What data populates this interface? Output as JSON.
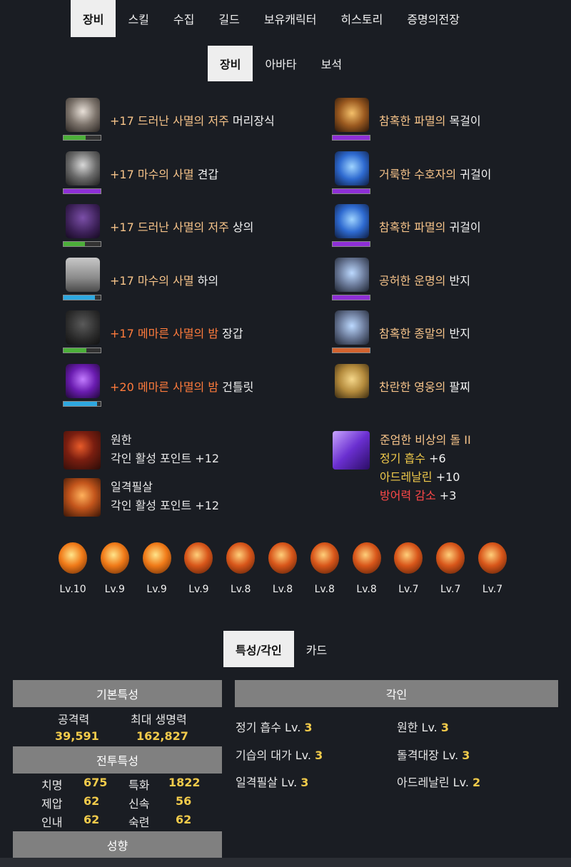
{
  "main_tabs": [
    "장비",
    "스킬",
    "수집",
    "길드",
    "보유캐릭터",
    "히스토리",
    "증명의전장"
  ],
  "sub_tabs": [
    "장비",
    "아바타",
    "보석"
  ],
  "equipment_left": [
    {
      "prefix": "+17 드러난 사멸의 저주",
      "slot": "머리장식",
      "prefix_color": "orange",
      "quality_color": "#4caf3a",
      "quality": 60,
      "icon": "helmet-icon"
    },
    {
      "prefix": "+17 마수의 사멸",
      "slot": "견갑",
      "prefix_color": "orange",
      "quality_color": "#8e2fd6",
      "quality": 100,
      "icon": "shoulder-icon"
    },
    {
      "prefix": "+17 드러난 사멸의 저주",
      "slot": "상의",
      "prefix_color": "orange",
      "quality_color": "#4caf3a",
      "quality": 58,
      "icon": "chest-icon"
    },
    {
      "prefix": "+17 마수의 사멸",
      "slot": "하의",
      "prefix_color": "orange",
      "quality_color": "#2ea8e0",
      "quality": 85,
      "icon": "pants-icon"
    },
    {
      "prefix": "+17 메마른 사멸의 밤",
      "slot": "장갑",
      "prefix_color": "red-orange",
      "quality_color": "#4caf3a",
      "quality": 62,
      "icon": "gloves-icon"
    },
    {
      "prefix": "+20 메마른 사멸의 밤",
      "slot": "건틀릿",
      "prefix_color": "red-orange",
      "quality_color": "#2ea8e0",
      "quality": 90,
      "icon": "gauntlet-icon"
    }
  ],
  "equipment_right": [
    {
      "prefix": "참혹한 파멸의",
      "slot": "목걸이",
      "quality_color": "#8e2fd6",
      "quality": 100,
      "icon": "necklace-icon"
    },
    {
      "prefix": "거룩한 수호자의",
      "slot": "귀걸이",
      "quality_color": "#8e2fd6",
      "quality": 100,
      "icon": "earring-icon"
    },
    {
      "prefix": "참혹한 파멸의",
      "slot": "귀걸이",
      "quality_color": "#8e2fd6",
      "quality": 100,
      "icon": "earring-icon"
    },
    {
      "prefix": "공허한 운명의",
      "slot": "반지",
      "quality_color": "#8e2fd6",
      "quality": 100,
      "icon": "ring-icon"
    },
    {
      "prefix": "참혹한 종말의",
      "slot": "반지",
      "quality_color": "#d3632f",
      "quality": 100,
      "icon": "ring-icon"
    },
    {
      "prefix": "찬란한 영웅의",
      "slot": "팔찌",
      "quality_color": "",
      "quality": 0,
      "icon": "bracelet-icon"
    }
  ],
  "engravings_books": [
    {
      "name": "원한",
      "effect": "각인 활성 포인트 +12",
      "icon": "grudge-icon"
    },
    {
      "name": "일격필살",
      "effect": "각인 활성 포인트 +12",
      "icon": "one-shot-icon"
    }
  ],
  "stone": {
    "name": "준엄한 비상의 돌 II",
    "lines": [
      {
        "name": "정기 흡수",
        "value": "+6",
        "color": "gold"
      },
      {
        "name": "아드레날린",
        "value": "+10",
        "color": "gold"
      },
      {
        "name": "방어력 감소",
        "value": "+3",
        "color": "redtxt"
      }
    ]
  },
  "gems": [
    {
      "level": "Lv.10",
      "type": "annihilation"
    },
    {
      "level": "Lv.9",
      "type": "annihilation"
    },
    {
      "level": "Lv.9",
      "type": "annihilation"
    },
    {
      "level": "Lv.9",
      "type": "crimson"
    },
    {
      "level": "Lv.8",
      "type": "crimson"
    },
    {
      "level": "Lv.8",
      "type": "crimson"
    },
    {
      "level": "Lv.8",
      "type": "crimson"
    },
    {
      "level": "Lv.8",
      "type": "crimson"
    },
    {
      "level": "Lv.7",
      "type": "crimson"
    },
    {
      "level": "Lv.7",
      "type": "crimson"
    },
    {
      "level": "Lv.7",
      "type": "crimson"
    }
  ],
  "bottom_tabs": [
    "특성/각인",
    "카드"
  ],
  "basic_stats": {
    "header": "기본특성",
    "attack_label": "공격력",
    "attack": "39,591",
    "hp_label": "최대 생명력",
    "hp": "162,827"
  },
  "combat_stats": {
    "header": "전투특성",
    "rows": [
      {
        "l1": "치명",
        "v1": "675",
        "l2": "특화",
        "v2": "1822"
      },
      {
        "l1": "제압",
        "v1": "62",
        "l2": "신속",
        "v2": "56"
      },
      {
        "l1": "인내",
        "v1": "62",
        "l2": "숙련",
        "v2": "62"
      }
    ]
  },
  "tendency_header": "성향",
  "engravings": {
    "header": "각인",
    "items": [
      {
        "name": "정기 흡수 Lv.",
        "lv": "3"
      },
      {
        "name": "원한 Lv.",
        "lv": "3"
      },
      {
        "name": "기습의 대가 Lv.",
        "lv": "3"
      },
      {
        "name": "돌격대장 Lv.",
        "lv": "3"
      },
      {
        "name": "일격필살 Lv.",
        "lv": "3"
      },
      {
        "name": "아드레날린 Lv.",
        "lv": "2"
      }
    ]
  }
}
